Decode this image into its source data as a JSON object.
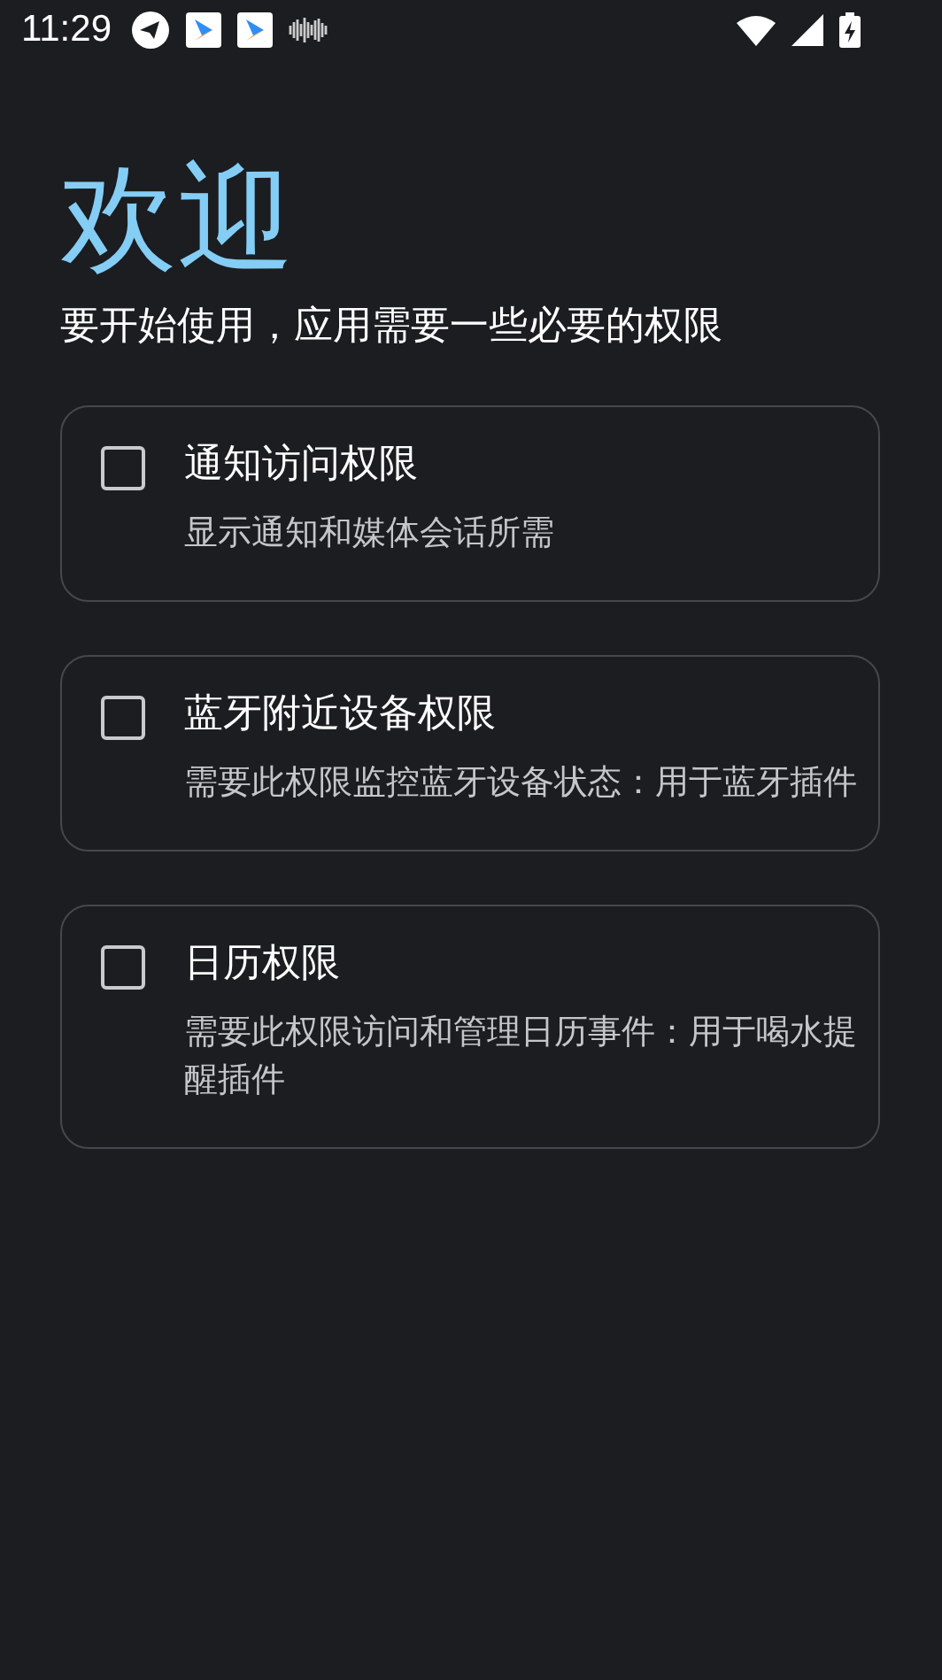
{
  "status_bar": {
    "time": "11:29"
  },
  "title": "欢迎",
  "subtitle": "要开始使用，应用需要一些必要的权限",
  "permissions": [
    {
      "title": "通知访问权限",
      "description": "显示通知和媒体会话所需",
      "checked": false
    },
    {
      "title": "蓝牙附近设备权限",
      "description": "需要此权限监控蓝牙设备状态：用于蓝牙插件",
      "checked": false
    },
    {
      "title": "日历权限",
      "description": "需要此权限访问和管理日历事件：用于喝水提醒插件",
      "checked": false
    }
  ]
}
